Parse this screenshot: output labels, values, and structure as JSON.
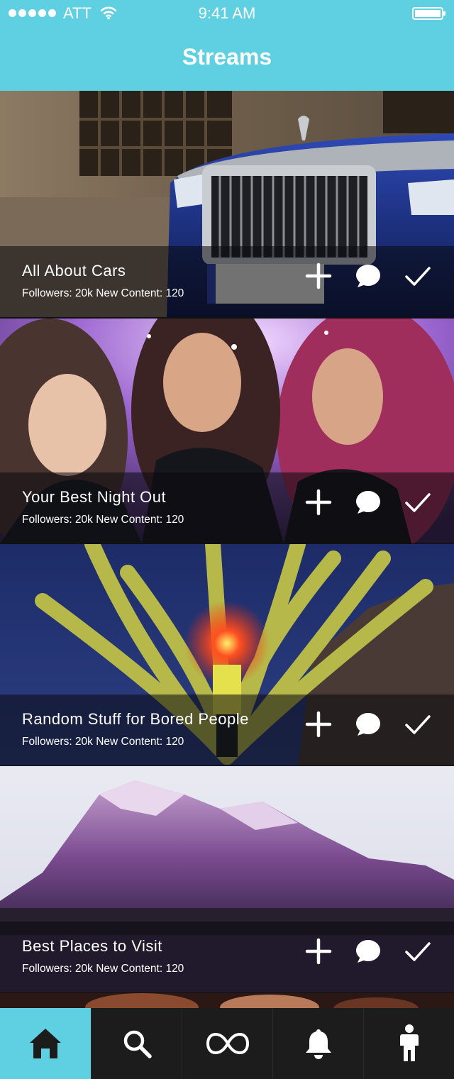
{
  "status_bar": {
    "carrier": "ATT",
    "time": "9:41 AM"
  },
  "header": {
    "title": "Streams"
  },
  "streams": [
    {
      "title": "All About Cars",
      "meta": "Followers: 20k New Content: 120"
    },
    {
      "title": "Your Best Night Out",
      "meta": "Followers: 20k New Content: 120"
    },
    {
      "title": "Random Stuff for Bored People",
      "meta": "Followers: 20k New Content: 120"
    },
    {
      "title": "Best Places to Visit",
      "meta": "Followers: 20k New Content: 120"
    }
  ],
  "actions": [
    "plus-icon",
    "chat-bubble-icon",
    "checkmark-icon"
  ],
  "tabs": [
    {
      "icon": "home-icon",
      "active": true
    },
    {
      "icon": "search-icon",
      "active": false
    },
    {
      "icon": "infinity-icon",
      "active": false
    },
    {
      "icon": "bell-icon",
      "active": false
    },
    {
      "icon": "person-icon",
      "active": false
    }
  ],
  "colors": {
    "accent": "#5fcfe2",
    "tabbar": "#1c1c1c",
    "icon_dark": "#1c1c1c",
    "icon_light": "#ffffff"
  }
}
